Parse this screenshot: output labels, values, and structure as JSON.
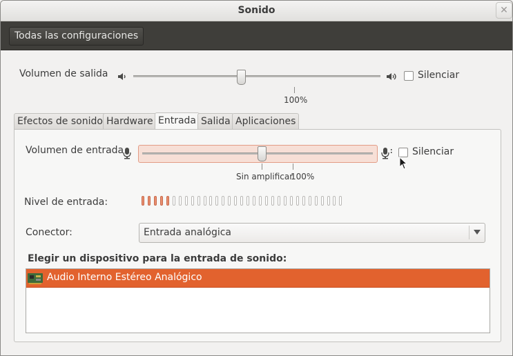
{
  "window": {
    "title": "Sonido",
    "close_icon": "close-icon"
  },
  "toolbar": {
    "all_settings_label": "Todas las configuraciones"
  },
  "output": {
    "label": "Volumen de salida",
    "level": 0.5,
    "level_text": "100%",
    "mute_label": "Silenciar",
    "muted": false
  },
  "tabs": [
    {
      "label": "Efectos de sonido",
      "active": false
    },
    {
      "label": "Hardware",
      "active": false
    },
    {
      "label": "Entrada",
      "active": true
    },
    {
      "label": "Salida",
      "active": false
    },
    {
      "label": "Aplicaciones",
      "active": false
    }
  ],
  "input": {
    "label": "Volumen de entrada",
    "level": 0.5,
    "unamplified_label": "Sin amplificar",
    "level_text": "100%",
    "mute_label": "Silenciar",
    "muted": false
  },
  "input_level": {
    "label": "Nivel de entrada:",
    "total_segments": 33,
    "lit_segments": 5
  },
  "connector": {
    "label": "Conector:",
    "value": "Entrada analógica"
  },
  "device_section": {
    "heading": "Elegir un dispositivo para la entrada de sonido:",
    "devices": [
      {
        "name": "Audio Interno Estéreo Analógico",
        "selected": true
      }
    ]
  },
  "colors": {
    "accent": "#e2622e",
    "toolbar_bg": "#3f3e3a",
    "level_lit": "#e88f70",
    "level_unlit": "#ffffff"
  }
}
